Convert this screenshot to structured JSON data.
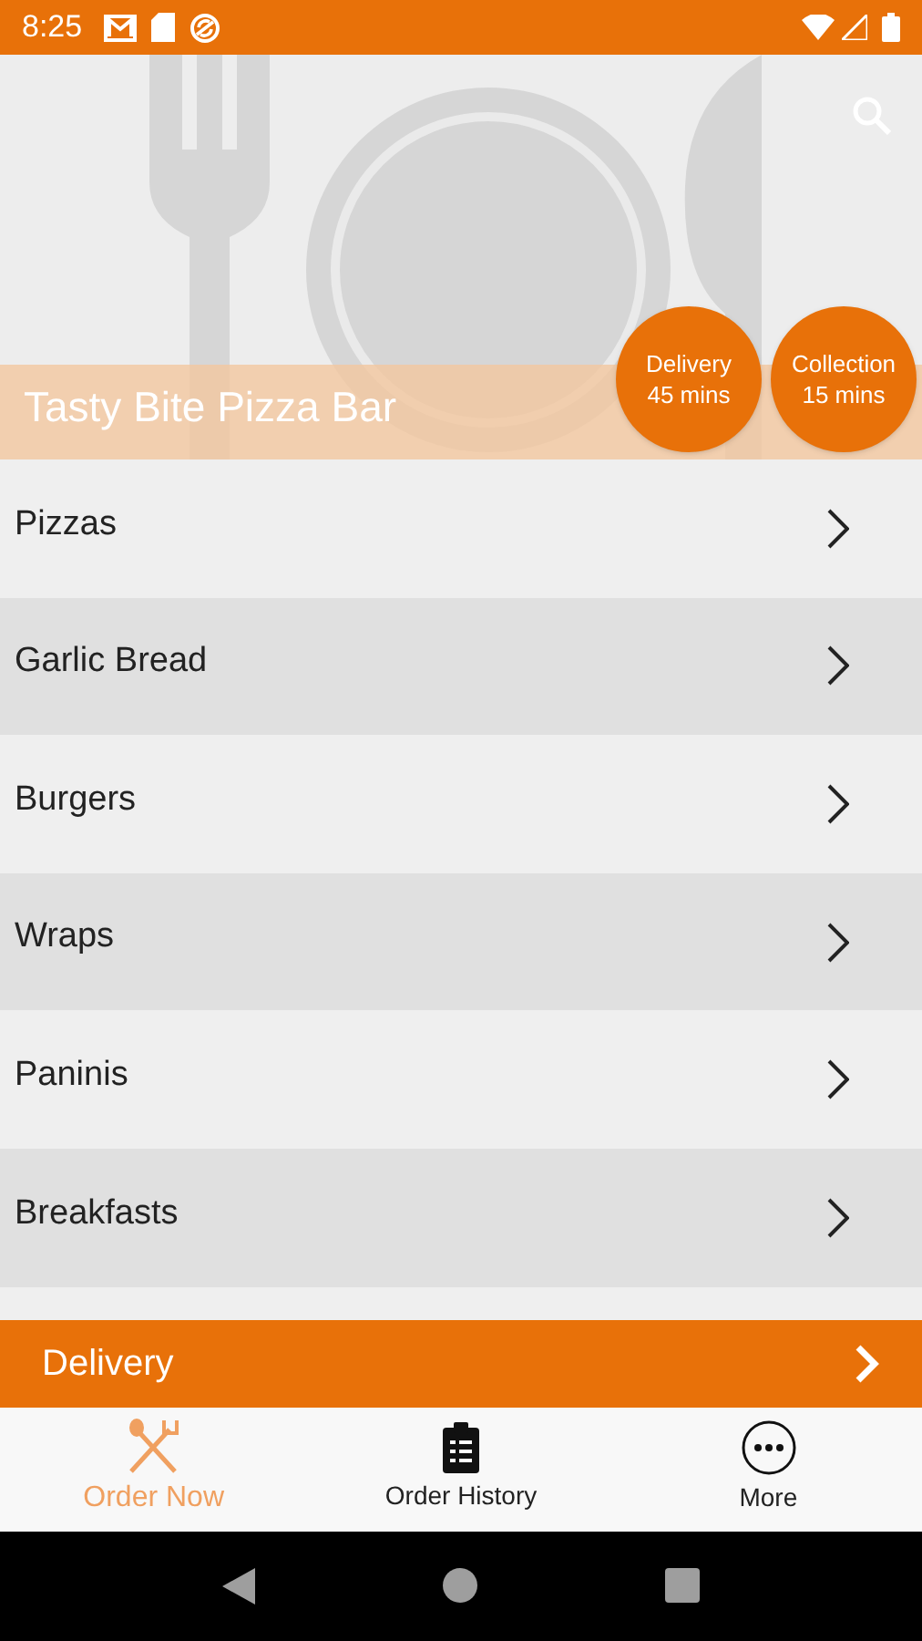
{
  "status_bar": {
    "time": "8:25"
  },
  "header": {
    "title": "Tasty Bite Pizza Bar",
    "badges": [
      {
        "label": "Delivery",
        "time": "45 mins"
      },
      {
        "label": "Collection",
        "time": "15 mins"
      }
    ]
  },
  "categories": [
    {
      "name": "Pizzas"
    },
    {
      "name": "Garlic Bread"
    },
    {
      "name": "Burgers"
    },
    {
      "name": "Wraps"
    },
    {
      "name": "Paninis"
    },
    {
      "name": "Breakfasts"
    }
  ],
  "order_mode": {
    "label": "Delivery"
  },
  "tabs": [
    {
      "label": "Order Now",
      "kind": "utensils",
      "selected": true
    },
    {
      "label": "Order History",
      "kind": "clipboard",
      "selected": false
    },
    {
      "label": "More",
      "kind": "more",
      "selected": false
    }
  ]
}
